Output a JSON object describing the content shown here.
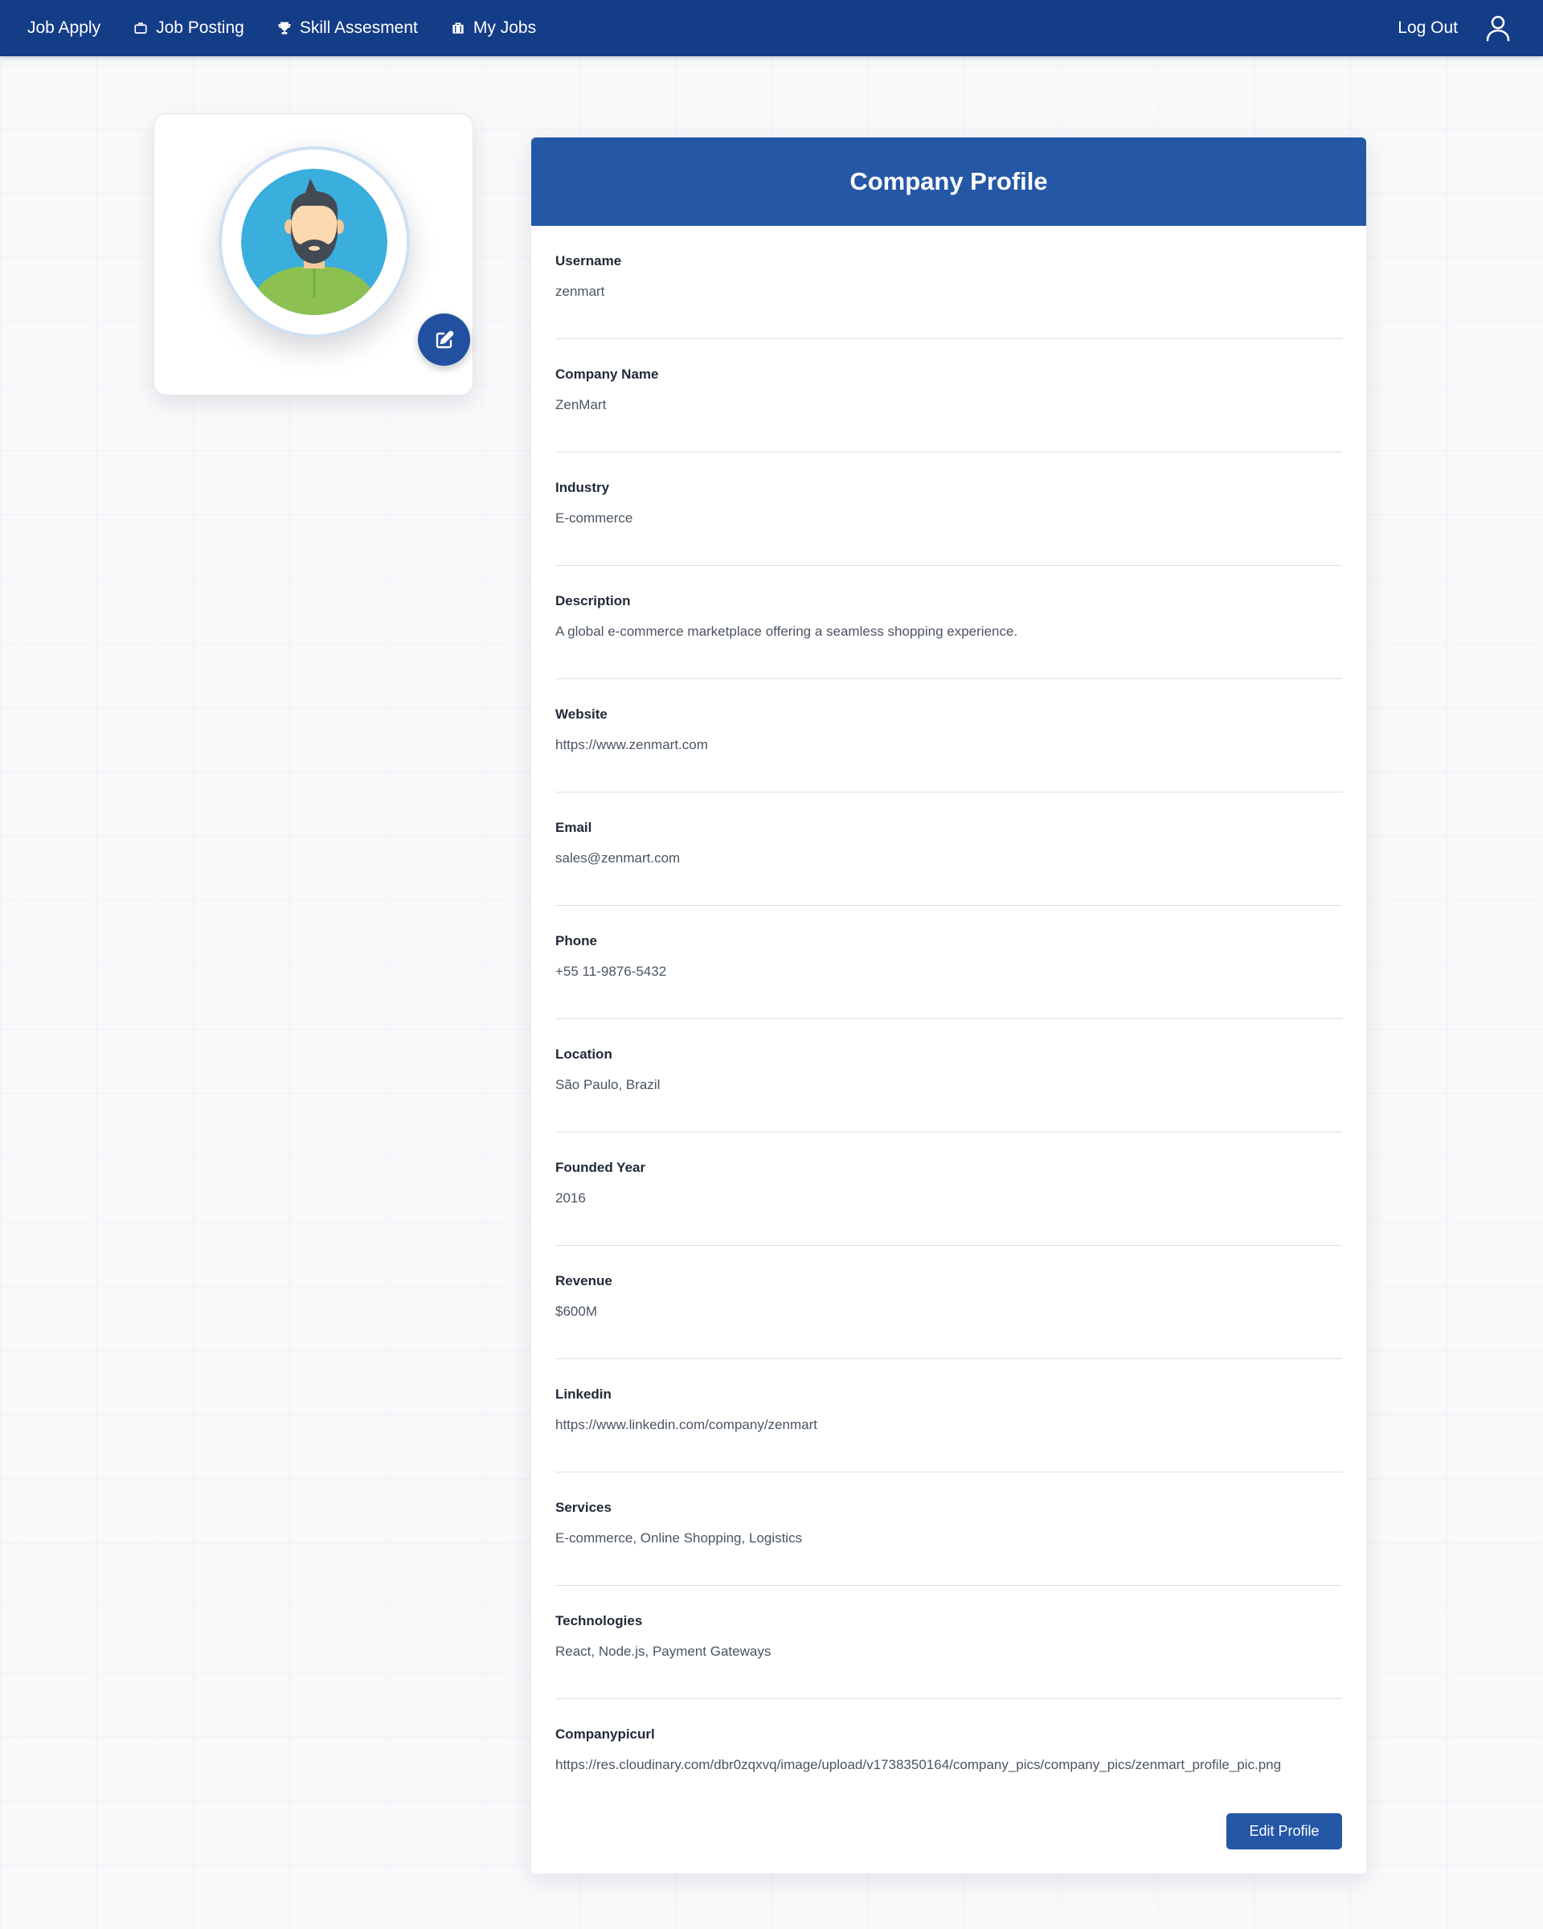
{
  "nav": {
    "items": [
      {
        "label": "Job Apply",
        "icon": ""
      },
      {
        "label": "Job Posting",
        "icon": "briefcase-icon"
      },
      {
        "label": "Skill Assesment",
        "icon": "trophy-icon"
      },
      {
        "label": "My Jobs",
        "icon": "suitcase-icon"
      }
    ],
    "logout_label": "Log Out",
    "user_icon": "user-icon"
  },
  "avatar": {
    "edit_icon": "edit-icon"
  },
  "profile": {
    "title": "Company Profile",
    "fields": [
      {
        "label": "Username",
        "value": "zenmart"
      },
      {
        "label": "Company Name",
        "value": "ZenMart"
      },
      {
        "label": "Industry",
        "value": "E-commerce"
      },
      {
        "label": "Description",
        "value": "A global e-commerce marketplace offering a seamless shopping experience."
      },
      {
        "label": "Website",
        "value": "https://www.zenmart.com"
      },
      {
        "label": "Email",
        "value": "sales@zenmart.com"
      },
      {
        "label": "Phone",
        "value": "+55 11-9876-5432"
      },
      {
        "label": "Location",
        "value": "São Paulo, Brazil"
      },
      {
        "label": "Founded Year",
        "value": "2016"
      },
      {
        "label": "Revenue",
        "value": "$600M"
      },
      {
        "label": "Linkedin",
        "value": "https://www.linkedin.com/company/zenmart"
      },
      {
        "label": "Services",
        "value": "E-commerce, Online Shopping, Logistics"
      },
      {
        "label": "Technologies",
        "value": "React, Node.js, Payment Gateways"
      },
      {
        "label": "Companypicurl",
        "value": "https://res.cloudinary.com/dbr0zqxvq/image/upload/v1738350164/company_pics/company_pics/zenmart_profile_pic.png"
      }
    ],
    "edit_label": "Edit Profile"
  },
  "colors": {
    "navbar": "#143d87",
    "header": "#2557a7",
    "button": "#2557a7",
    "background": "#f8f9fb"
  }
}
